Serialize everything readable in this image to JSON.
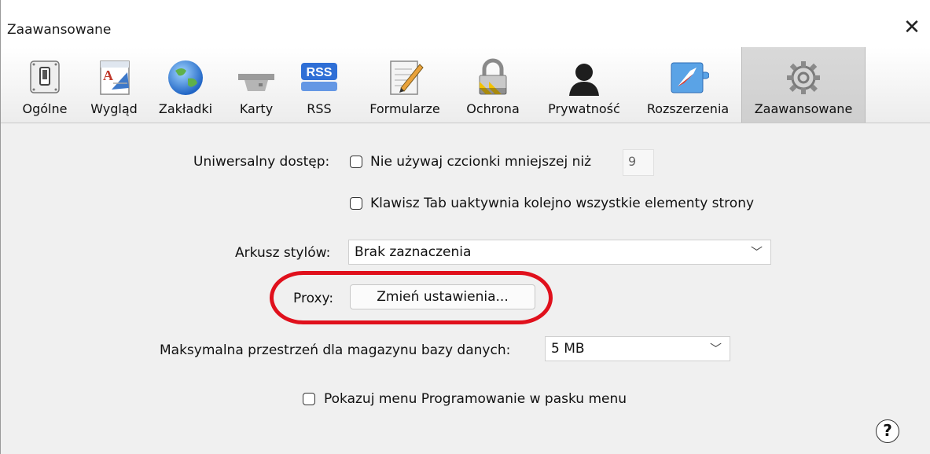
{
  "window": {
    "title": "Zaawansowane",
    "close_symbol": "✕"
  },
  "toolbar": {
    "items": [
      {
        "label": "Ogólne",
        "icon": "general-switch-icon"
      },
      {
        "label": "Wygląd",
        "icon": "appearance-icon"
      },
      {
        "label": "Zakładki",
        "icon": "globe-icon"
      },
      {
        "label": "Karty",
        "icon": "tabs-icon"
      },
      {
        "label": "RSS",
        "icon": "rss-icon",
        "icon_text": "RSS"
      },
      {
        "label": "Formularze",
        "icon": "forms-pencil-icon"
      },
      {
        "label": "Ochrona",
        "icon": "lock-icon"
      },
      {
        "label": "Prywatność",
        "icon": "person-silhouette-icon"
      },
      {
        "label": "Rozszerzenia",
        "icon": "extensions-compass-icon"
      },
      {
        "label": "Zaawansowane",
        "icon": "gears-icon",
        "active": true
      }
    ]
  },
  "accessibility": {
    "label": "Uniwersalny dostęp:",
    "min_font_checkbox_label": "Nie używaj czcionki mniejszej niż",
    "min_font_value": "9",
    "tab_checkbox_label": "Klawisz Tab uaktywnia kolejno wszystkie elementy strony"
  },
  "stylesheet": {
    "label": "Arkusz stylów:",
    "value": "Brak zaznaczenia"
  },
  "proxy": {
    "label": "Proxy:",
    "button_label": "Zmień ustawienia..."
  },
  "database": {
    "label": "Maksymalna przestrzeń dla magazynu bazy danych:",
    "value": "5 MB"
  },
  "develop_menu": {
    "checkbox_label": "Pokazuj menu Programowanie w pasku menu"
  },
  "help": {
    "symbol": "?"
  },
  "colors": {
    "highlight": "#e0101c",
    "active_tab": "#d4d4d4"
  }
}
